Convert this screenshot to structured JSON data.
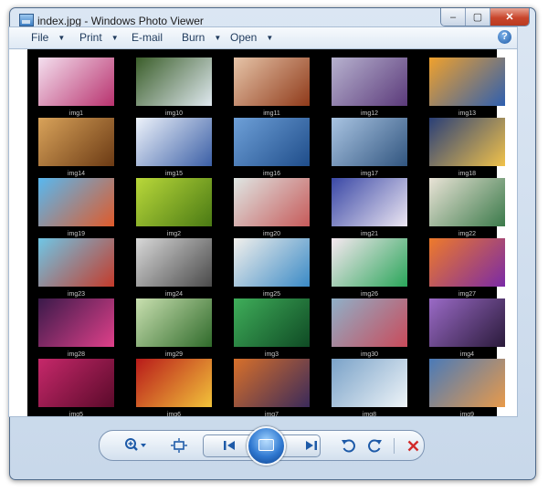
{
  "window": {
    "title": "index.jpg - Windows Photo Viewer"
  },
  "caption_buttons": {
    "minimize": "–",
    "maximize": "▢",
    "close": "✕"
  },
  "menu": {
    "items": [
      {
        "label": "File",
        "has_arrow": true
      },
      {
        "label": "Print",
        "has_arrow": true
      },
      {
        "label": "E-mail",
        "has_arrow": false
      },
      {
        "label": "Burn",
        "has_arrow": true
      },
      {
        "label": "Open",
        "has_arrow": true
      }
    ],
    "help": "?"
  },
  "thumbnails": [
    {
      "label": "img1",
      "c1": "#f4e0ef",
      "c2": "#b8326e"
    },
    {
      "label": "img10",
      "c1": "#3b5e2a",
      "c2": "#dfe8ef"
    },
    {
      "label": "img11",
      "c1": "#e6c4a8",
      "c2": "#8f3a1a"
    },
    {
      "label": "img12",
      "c1": "#b7b2cf",
      "c2": "#5b3a7a"
    },
    {
      "label": "img13",
      "c1": "#f0a12c",
      "c2": "#2e5fb0"
    },
    {
      "label": "img14",
      "c1": "#d9a35a",
      "c2": "#6b3a14"
    },
    {
      "label": "img15",
      "c1": "#eef3fb",
      "c2": "#3b5fa6"
    },
    {
      "label": "img16",
      "c1": "#6ea0d8",
      "c2": "#1f4d8a"
    },
    {
      "label": "img17",
      "c1": "#a9c4e2",
      "c2": "#31557f"
    },
    {
      "label": "img18",
      "c1": "#2a3f77",
      "c2": "#f1c24a"
    },
    {
      "label": "img19",
      "c1": "#58b8f0",
      "c2": "#e05a2a"
    },
    {
      "label": "img2",
      "c1": "#b9d83a",
      "c2": "#4a7a14"
    },
    {
      "label": "img20",
      "c1": "#dfe6e3",
      "c2": "#c65a5a"
    },
    {
      "label": "img21",
      "c1": "#3a48a6",
      "c2": "#ece6f2"
    },
    {
      "label": "img22",
      "c1": "#e9e3d6",
      "c2": "#3b7a4a"
    },
    {
      "label": "img23",
      "c1": "#6fc6e6",
      "c2": "#c43a2a"
    },
    {
      "label": "img24",
      "c1": "#d8d8d8",
      "c2": "#4a4a4a"
    },
    {
      "label": "img25",
      "c1": "#f2f0ec",
      "c2": "#3a8ac6"
    },
    {
      "label": "img26",
      "c1": "#f6e8f0",
      "c2": "#2aa65a"
    },
    {
      "label": "img27",
      "c1": "#ee7a2a",
      "c2": "#7a2aa6"
    },
    {
      "label": "img28",
      "c1": "#3a1a4a",
      "c2": "#e0408a"
    },
    {
      "label": "img29",
      "c1": "#c9e0b0",
      "c2": "#2f6a2a"
    },
    {
      "label": "img3",
      "c1": "#3fae5a",
      "c2": "#0f4a24"
    },
    {
      "label": "img30",
      "c1": "#8fb0c8",
      "c2": "#c94a5a"
    },
    {
      "label": "img4",
      "c1": "#9a6ac6",
      "c2": "#2a1a3a"
    },
    {
      "label": "img5",
      "c1": "#c6286a",
      "c2": "#5a0a2a"
    },
    {
      "label": "img6",
      "c1": "#b81a1a",
      "c2": "#f2c33a"
    },
    {
      "label": "img7",
      "c1": "#d8702a",
      "c2": "#3a2a5a"
    },
    {
      "label": "img8",
      "c1": "#7aa2c8",
      "c2": "#eef4f8"
    },
    {
      "label": "img9",
      "c1": "#4a7ab8",
      "c2": "#e89a4a"
    }
  ],
  "toolbar": {
    "zoom": "zoom-icon",
    "actual_size": "actual-size-icon",
    "previous": "previous-icon",
    "slideshow": "slideshow-icon",
    "next": "next-icon",
    "rotate_ccw": "rotate-counterclockwise-icon",
    "rotate_cw": "rotate-clockwise-icon",
    "delete": "delete-icon"
  },
  "colors": {
    "grid_bg": "#000000",
    "accent": "#1d5aa8",
    "delete": "#d12a2a"
  }
}
